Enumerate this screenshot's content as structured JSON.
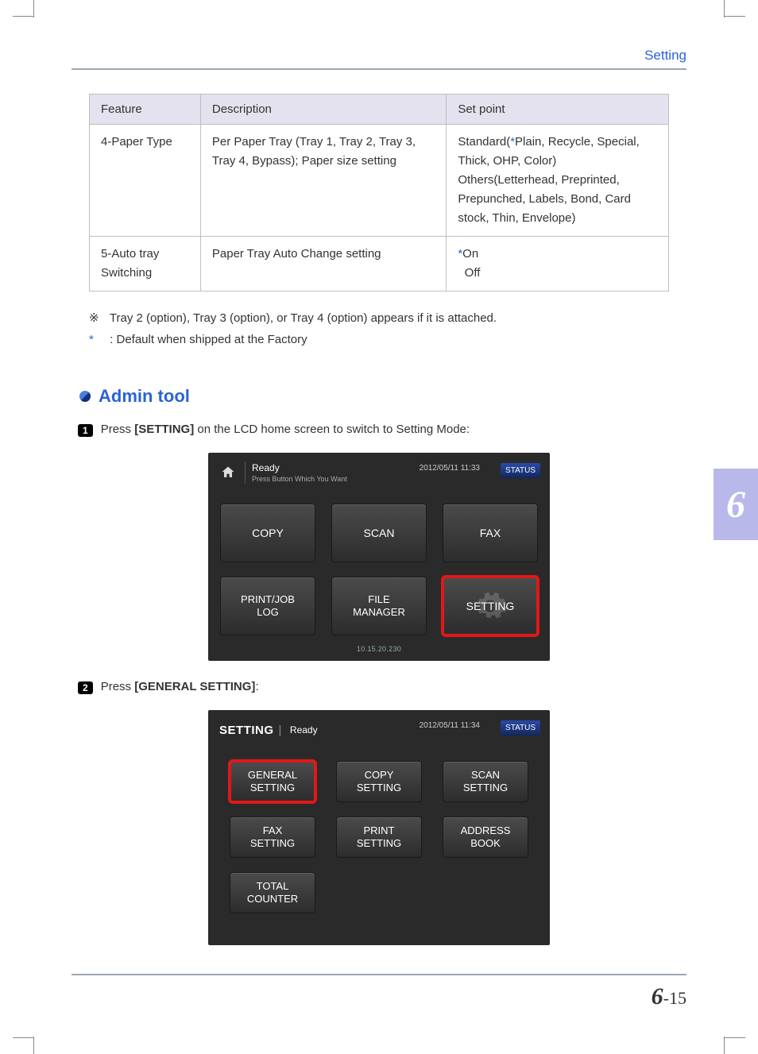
{
  "header": {
    "title": "Setting"
  },
  "table": {
    "headers": {
      "feature": "Feature",
      "description": "Description",
      "setpoint": "Set point"
    },
    "rows": [
      {
        "feature": "4-Paper Type",
        "description": "Per Paper Tray (Tray 1, Tray 2,  Tray 3, Tray 4, Bypass); Paper size setting",
        "setpoint_pre": "Standard(",
        "setpoint_ast": "*",
        "setpoint_post": "Plain, Recycle, Special, Thick, OHP, Color) Others(Letterhead, Preprinted, Prepunched, Labels, Bond, Card stock, Thin, Envelope)"
      },
      {
        "feature": "5-Auto tray Switching",
        "description": "Paper Tray Auto Change setting",
        "setpoint_on_ast": "*",
        "setpoint_on": "On",
        "setpoint_off": "  Off"
      }
    ]
  },
  "notes": {
    "n1_sym": "※",
    "n1_text": " Tray 2 (option), Tray 3 (option), or Tray 4 (option) appears if it is attached.",
    "n2_sym": "*",
    "n2_text": " : Default when shipped at the Factory"
  },
  "section": {
    "title": "Admin tool"
  },
  "steps": {
    "s1": {
      "num": "1",
      "pre": "Press  ",
      "bold": "[SETTING]",
      "post": " on the LCD home screen to switch to Setting Mode:"
    },
    "s2": {
      "num": "2",
      "pre": "Press ",
      "bold": "[GENERAL SETTING]",
      "post": ":"
    }
  },
  "lcd1": {
    "ready": "Ready",
    "sub": "Press Button Which You Want",
    "datetime": "2012/05/11 11:33",
    "status": "STATUS",
    "ip": "10.15.20.230",
    "buttons": [
      "COPY",
      "SCAN",
      "FAX",
      "PRINT/JOB\nLOG",
      "FILE\nMANAGER",
      "SETTING"
    ]
  },
  "lcd2": {
    "crumb": "SETTING",
    "ready": "Ready",
    "datetime": "2012/05/11 11:34",
    "status": "STATUS",
    "buttons": [
      "GENERAL\nSETTING",
      "COPY\nSETTING",
      "SCAN\nSETTING",
      "FAX\nSETTING",
      "PRINT\nSETTING",
      "ADDRESS\nBOOK",
      "TOTAL\nCOUNTER"
    ]
  },
  "chapter_tab": "6",
  "pagenum": {
    "chapter": "6",
    "sep": "-",
    "page": "15"
  }
}
